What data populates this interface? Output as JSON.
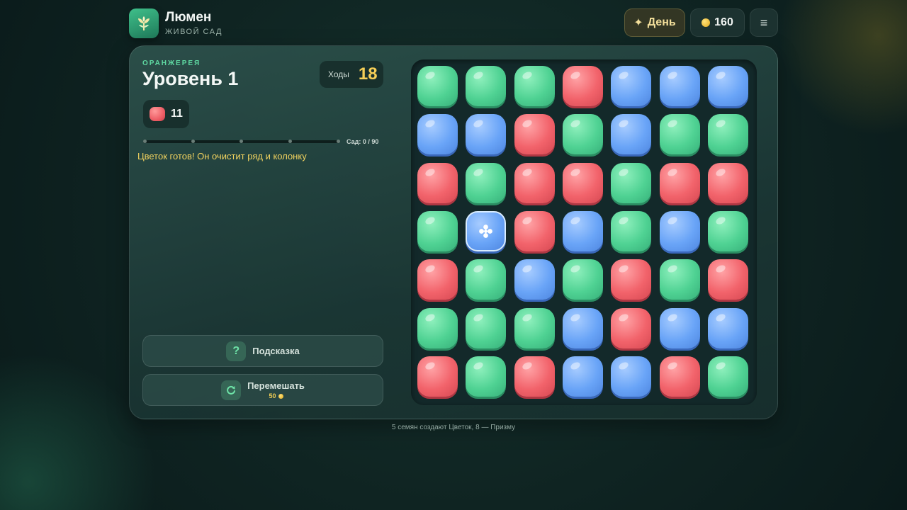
{
  "header": {
    "app_title": "Люмен",
    "app_subtitle": "ЖИВОЙ САД",
    "day_label": "День",
    "coins": "160",
    "menu_symbol": "≡"
  },
  "level": {
    "area_label": "ОРАНЖЕРЕЯ",
    "title": "Уровень 1",
    "moves_label": "Ходы",
    "moves": "18",
    "goal_count": "11",
    "goal_color": "red",
    "garden_progress_label": "Сад: 0 / 90",
    "garden_progress": 0,
    "message": "Цветок готов! Он очистит ряд и колонку"
  },
  "actions": {
    "hint_label": "Подсказка",
    "hint_icon": "?",
    "shuffle_label": "Перемешать",
    "shuffle_cost": "50"
  },
  "board": {
    "rows": [
      [
        "green",
        "green",
        "green",
        "red",
        "blue",
        "blue",
        "blue"
      ],
      [
        "blue",
        "blue",
        "red",
        "green",
        "blue",
        "green",
        "green"
      ],
      [
        "red",
        "green",
        "red",
        "red",
        "green",
        "red",
        "red"
      ],
      [
        "green",
        "blue-flower",
        "red",
        "blue",
        "green",
        "blue",
        "green"
      ],
      [
        "red",
        "green",
        "blue",
        "green",
        "red",
        "green",
        "red"
      ],
      [
        "green",
        "green",
        "green",
        "blue",
        "red",
        "blue",
        "blue"
      ],
      [
        "red",
        "green",
        "red",
        "blue",
        "blue",
        "red",
        "green"
      ]
    ]
  },
  "footer": {
    "note": "5 семян создают Цветок, 8 — Призму"
  },
  "colors": {
    "accent": "#5fd9a2",
    "moves": "#f6cf57",
    "message": "#f2d35f",
    "gem_green": "#4fd293",
    "gem_red": "#f2636b",
    "gem_blue": "#69a4f7"
  }
}
